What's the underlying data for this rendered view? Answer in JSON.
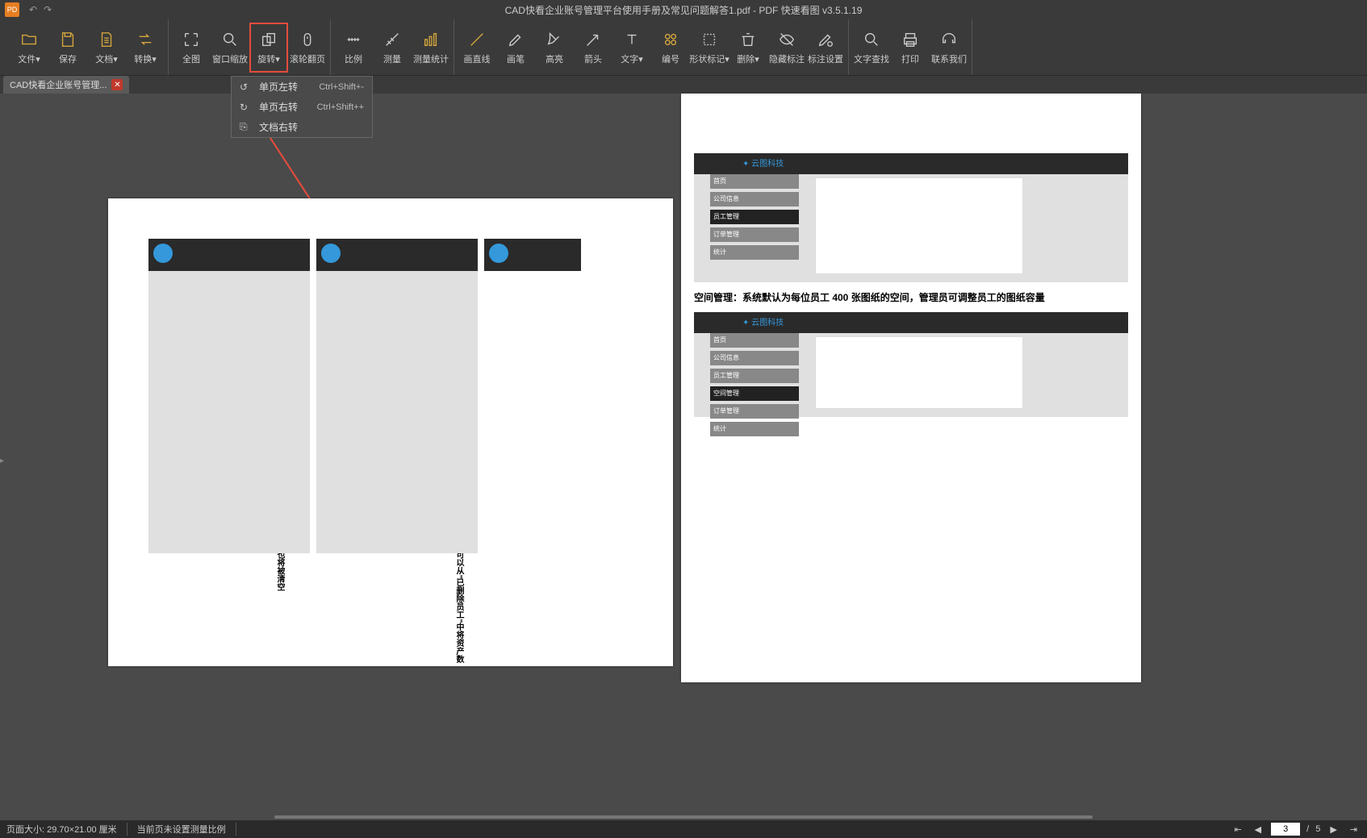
{
  "app": {
    "title_doc": "CAD快看企业账号管理平台使用手册及常见问题解答1.pdf",
    "title_app": "PDF 快速看图 v3.5.1.19",
    "icon_text": "PD"
  },
  "toolbar": [
    {
      "name": "file",
      "label": "文件▾",
      "icon": "folder",
      "accent": true
    },
    {
      "name": "save",
      "label": "保存",
      "icon": "save",
      "accent": true
    },
    {
      "name": "doc",
      "label": "文档▾",
      "icon": "doc",
      "accent": true
    },
    {
      "name": "convert",
      "label": "转换▾",
      "icon": "convert",
      "accent": true
    },
    {
      "name": "fit",
      "label": "全图",
      "icon": "fit"
    },
    {
      "name": "zoomwin",
      "label": "窗口缩放",
      "icon": "zoomwin"
    },
    {
      "name": "rotate",
      "label": "旋转▾",
      "icon": "rotate",
      "active": true
    },
    {
      "name": "scroll",
      "label": "滚轮翻页",
      "icon": "scroll"
    },
    {
      "name": "scale",
      "label": "比例",
      "icon": "scale"
    },
    {
      "name": "measure",
      "label": "测量",
      "icon": "measure"
    },
    {
      "name": "stats",
      "label": "测量统计",
      "icon": "stats",
      "accent": true
    },
    {
      "name": "line",
      "label": "画直线",
      "icon": "line",
      "accent": true
    },
    {
      "name": "pen",
      "label": "画笔",
      "icon": "pen"
    },
    {
      "name": "highlight",
      "label": "高亮",
      "icon": "highlight"
    },
    {
      "name": "arrow",
      "label": "箭头",
      "icon": "arrow"
    },
    {
      "name": "text",
      "label": "文字▾",
      "icon": "text"
    },
    {
      "name": "number",
      "label": "编号",
      "icon": "number",
      "accent": true
    },
    {
      "name": "shape",
      "label": "形状标记▾",
      "icon": "shape"
    },
    {
      "name": "delete",
      "label": "删除▾",
      "icon": "delete"
    },
    {
      "name": "hidemark",
      "label": "隐藏标注",
      "icon": "hidemark"
    },
    {
      "name": "marksettings",
      "label": "标注设置",
      "icon": "marksettings"
    },
    {
      "name": "findtext",
      "label": "文字查找",
      "icon": "findtext"
    },
    {
      "name": "print",
      "label": "打印",
      "icon": "print"
    },
    {
      "name": "contact",
      "label": "联系我们",
      "icon": "contact"
    }
  ],
  "toolbar_groups": [
    [
      0,
      1,
      2,
      3
    ],
    [
      4,
      5,
      6,
      7
    ],
    [
      8,
      9,
      10
    ],
    [
      11,
      12,
      13,
      14,
      15,
      16,
      17,
      18,
      19,
      20
    ],
    [
      21,
      22,
      23
    ]
  ],
  "dropdown": {
    "items": [
      {
        "icon": "↺",
        "label": "单页左转",
        "shortcut": "Ctrl+Shift+-"
      },
      {
        "icon": "↻",
        "label": "单页右转",
        "shortcut": "Ctrl+Shift++"
      },
      {
        "icon": "⎘",
        "label": "文档右转",
        "shortcut": ""
      }
    ]
  },
  "tab": {
    "label": "CAD快看企业账号管理..."
  },
  "page1": {
    "caption1": "\"删除\"表示将删除该员工所有资产，即该员工不再是 CAD 快看会员，他的云盘数据也将被清空",
    "caption2": "\"暂不处理\"表示该员工不再是 CAD 快看会员，但他的云盘数据不会被清空，管理员可以从\"已删除员工\"中将资产数据交接给其他员工"
  },
  "page2": {
    "heading": "空间管理：系统默认为每位员工 400 张图纸的空间，管理员可调整员工的图纸容量"
  },
  "status": {
    "page_size": "页面大小: 29.70×21.00 厘米",
    "scale_msg": "当前页未设置测量比例",
    "current_page": "3",
    "total_pages": "5"
  },
  "gutter": "▸"
}
